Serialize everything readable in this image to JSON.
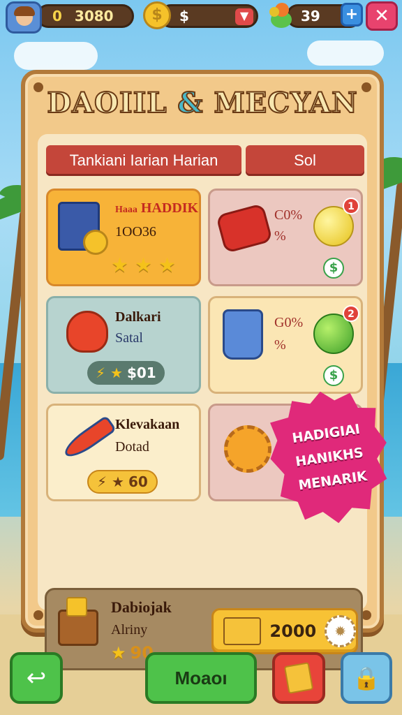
{
  "topbar": {
    "coins_prefix": "0",
    "coins": "3080",
    "coin_symbol": "$",
    "dollar_label": "$",
    "gems": "39",
    "plus_label": "+",
    "close_label": "✕"
  },
  "panel": {
    "title_left": "DAOIIL",
    "title_amp": "&",
    "title_right": "MECYAN",
    "tabs": [
      "Tankiani Iarian Harian",
      "Sol"
    ]
  },
  "cards": [
    {
      "name": "HADDIK",
      "name_prefix": "Haaa",
      "sub": "1OO36",
      "stars": "★ ★ ★"
    },
    {
      "pct": "C0%",
      "pct2": "%",
      "badge": "1",
      "dollar": "$"
    },
    {
      "name": "Dalkari",
      "sub": "Satal",
      "price": "$01",
      "price_icons": "⚡ ★"
    },
    {
      "pct": "G0%",
      "pct2": "%",
      "badge": "2",
      "dollar": "$"
    },
    {
      "name": "Klevakaan",
      "sub": "Dotad",
      "price": "60",
      "price_icons": "⚡ ★"
    }
  ],
  "promo": [
    "HADIGIAI",
    "HANIKHS",
    "MENARIK"
  ],
  "chest": {
    "name": "Dabiojak",
    "sub": "Alriny",
    "price": "90",
    "cost": "2000",
    "cog": "✹"
  },
  "bottom": {
    "main_label": "Moaoı",
    "back_icon": "↩",
    "lock_icon": "🔒"
  },
  "colors": {
    "panel": "#f2c98a",
    "panel_border": "#b27a3a",
    "tab_red": "#c4463a",
    "promo_pink": "#e0297a",
    "green_button": "#4ec24a"
  }
}
